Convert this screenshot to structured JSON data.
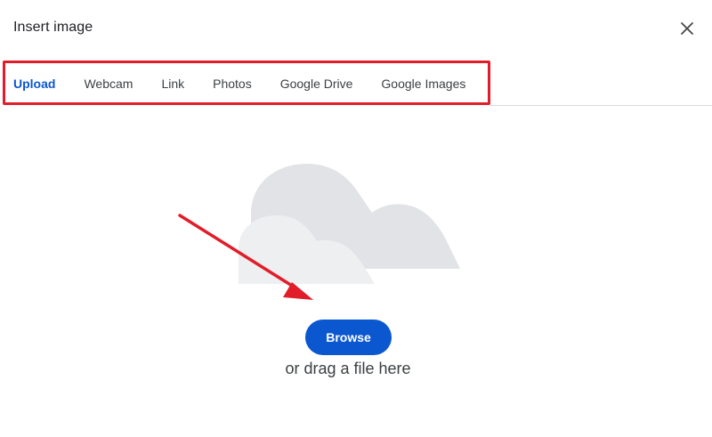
{
  "dialog": {
    "title": "Insert image",
    "close_icon": "close-icon"
  },
  "tabs": [
    {
      "label": "Upload",
      "active": true
    },
    {
      "label": "Webcam",
      "active": false
    },
    {
      "label": "Link",
      "active": false
    },
    {
      "label": "Photos",
      "active": false
    },
    {
      "label": "Google Drive",
      "active": false
    },
    {
      "label": "Google Images",
      "active": false
    }
  ],
  "upload": {
    "illustration": "cloud-illustration",
    "browse_label": "Browse",
    "drag_text": "or drag a file here"
  },
  "annotations": {
    "highlight_color": "#e11d2a",
    "arrow_color": "#e11d2a"
  },
  "colors": {
    "accent": "#0b57d0",
    "cloud_back": "#e2e3e6",
    "cloud_front": "#eeeff1"
  }
}
